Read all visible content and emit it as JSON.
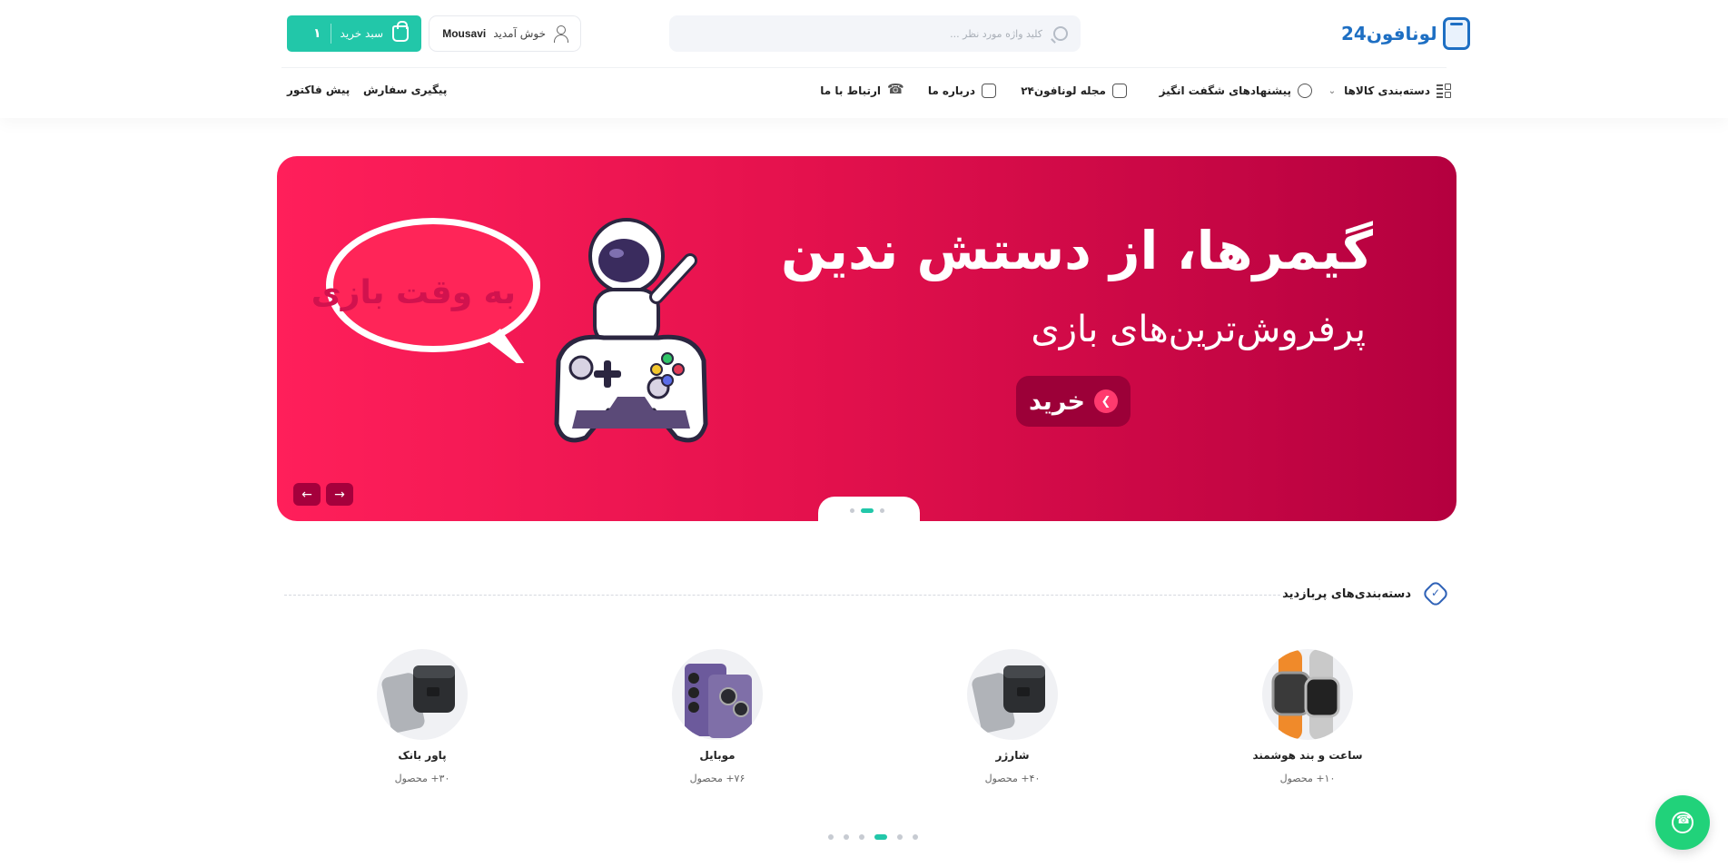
{
  "header": {
    "logo_text": "لونافون24",
    "search_placeholder": "کلید واژه مورد نظر ...",
    "user": {
      "greeting": "خوش آمدید",
      "name": "Mousavi"
    },
    "cart": {
      "label": "سبد خرید",
      "count": "۱"
    }
  },
  "nav": {
    "items": [
      {
        "label": "دسته‌بندی کالاها",
        "icon": "category-grid-icon"
      },
      {
        "label": "پیشنهادهای شگفت انگیز",
        "icon": "award-icon"
      },
      {
        "label": "مجله لونافون۲۴",
        "icon": "magazine-icon"
      },
      {
        "label": "درباره ما",
        "icon": "document-icon"
      },
      {
        "label": "ارتباط با ما",
        "icon": "phone-icon"
      }
    ],
    "left_links": [
      {
        "label": "پیگیری سفارش"
      },
      {
        "label": "پیش فاکتور"
      }
    ]
  },
  "banner": {
    "title": "گیمرها، از دستش ندین",
    "subtitle": "پرفروش‌ترین‌های بازی",
    "button_label": "خرید",
    "bubble_text": "به وقت بازی",
    "colors": {
      "from": "#ff1f5a",
      "to": "#b4003f",
      "button": "#9c0038"
    }
  },
  "categories": {
    "title": "دسته‌بندی‌های پربازدید",
    "items": [
      {
        "name": "ساعت و بند هوشمند",
        "count": "۱۰+ محصول",
        "image": "smart-watch"
      },
      {
        "name": "شارژر",
        "count": "۴۰+ محصول",
        "image": "charger"
      },
      {
        "name": "موبایل",
        "count": "۷۶+ محصول",
        "image": "mobile"
      },
      {
        "name": "پاور بانک",
        "count": "۳۰+ محصول",
        "image": "power-bank"
      }
    ]
  },
  "colors": {
    "accent": "#22c7a9",
    "brand": "#1e6fc3",
    "whatsapp": "#21d27a"
  }
}
